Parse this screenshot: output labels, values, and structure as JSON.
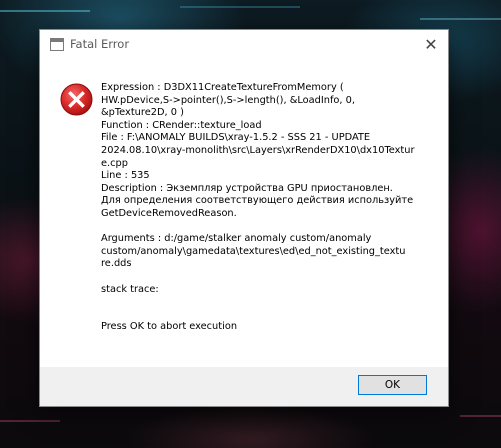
{
  "window": {
    "title": "Fatal Error",
    "close_glyph": "✕"
  },
  "icon": "error-icon",
  "message_lines": [
    "Expression    : D3DX11CreateTextureFromMemory (",
    "HW.pDevice,S->pointer(),S->length(), &LoadInfo, 0,",
    "&pTexture2D, 0 )",
    "Function      : CRender::texture_load",
    "File          : F:\\ANOMALY BUILDS\\xray-1.5.2 - SSS 21 - UPDATE",
    "2024.08.10\\xray-monolith\\src\\Layers\\xrRenderDX10\\dx10Textur",
    "e.cpp",
    "Line          : 535",
    "Description   : Экземпляр устройства GPU приостановлен.",
    "Для определения соответствующего действия используйте",
    "GetDeviceRemovedReason.",
    "",
    "Arguments     : d:/game/stalker anomaly custom/anomaly",
    "custom/anomaly\\gamedata\\textures\\ed\\ed_not_existing_textu",
    "re.dds",
    "",
    "stack trace:",
    "",
    "",
    "Press OK to abort execution"
  ],
  "buttons": {
    "ok_label": "OK"
  },
  "colors": {
    "error_red": "#e02424",
    "focus_border": "#0078d7",
    "footer_bg": "#f0f0f0"
  }
}
